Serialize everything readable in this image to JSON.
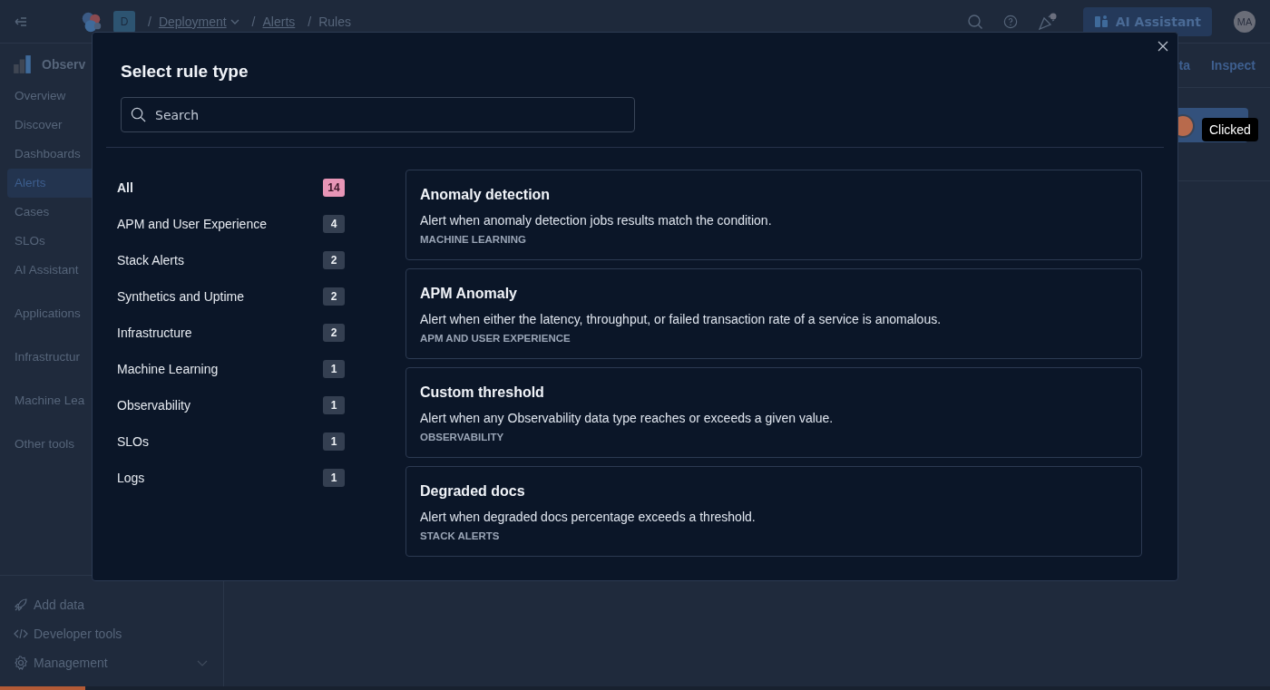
{
  "header": {
    "breadcrumbs": [
      {
        "label": "Deployment",
        "separator": "/",
        "dropdown": true
      },
      {
        "label": "Alerts",
        "separator": "/",
        "dropdown": false
      },
      {
        "label": "Rules",
        "separator": "/",
        "dropdown": false
      }
    ],
    "space_badge": "D",
    "ai_button": "AI Assistant",
    "avatar": "MA"
  },
  "sidebar": {
    "title": "Observ",
    "items": [
      {
        "label": "Overview",
        "selected": false
      },
      {
        "label": "Discover",
        "selected": false
      },
      {
        "label": "Dashboards",
        "selected": false
      },
      {
        "label": "Alerts",
        "selected": true
      },
      {
        "label": "Cases",
        "selected": false
      },
      {
        "label": "SLOs",
        "selected": false
      },
      {
        "label": "AI Assistant",
        "selected": false
      }
    ],
    "sections": [
      "Applications",
      "Infrastructur",
      "Machine Lea",
      "Other tools"
    ],
    "footer": [
      {
        "kind": "rocket",
        "label": "Add data"
      },
      {
        "kind": "code",
        "label": "Developer tools"
      },
      {
        "kind": "gear",
        "label": "Management"
      }
    ]
  },
  "page_tabs": [
    "ta",
    "Inspect"
  ],
  "loading_bar": {
    "level": 0.067
  },
  "tooltip": "Clicked",
  "modal": {
    "title": "Select rule type",
    "search": {
      "placeholder": "Search"
    },
    "categories": [
      {
        "label": "All",
        "count": "14",
        "selected": true
      },
      {
        "label": "APM and User Experience",
        "count": "4",
        "selected": false
      },
      {
        "label": "Stack Alerts",
        "count": "2",
        "selected": false
      },
      {
        "label": "Synthetics and Uptime",
        "count": "2",
        "selected": false
      },
      {
        "label": "Infrastructure",
        "count": "2",
        "selected": false
      },
      {
        "label": "Machine Learning",
        "count": "1",
        "selected": false
      },
      {
        "label": "Observability",
        "count": "1",
        "selected": false
      },
      {
        "label": "SLOs",
        "count": "1",
        "selected": false
      },
      {
        "label": "Logs",
        "count": "1",
        "selected": false
      }
    ],
    "rules": [
      {
        "title": "Anomaly detection",
        "description": "Alert when anomaly detection jobs results match the condition.",
        "category": "MACHINE LEARNING"
      },
      {
        "title": "APM Anomaly",
        "description": "Alert when either the latency, throughput, or failed transaction rate of a service is anomalous.",
        "category": "APM AND USER EXPERIENCE"
      },
      {
        "title": "Custom threshold",
        "description": "Alert when any Observability data type reaches or exceeds a given value.",
        "category": "OBSERVABILITY"
      },
      {
        "title": "Degraded docs",
        "description": "Alert when degraded docs percentage exceeds a threshold.",
        "category": "STACK ALERTS"
      }
    ]
  }
}
